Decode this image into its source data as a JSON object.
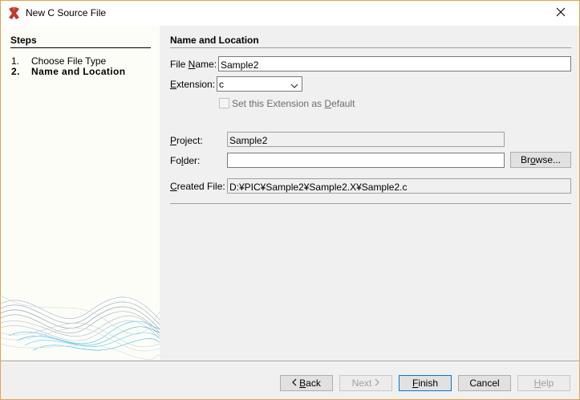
{
  "window": {
    "title": "New C Source File",
    "accent_color": "#e5a34a"
  },
  "steps": {
    "heading": "Steps",
    "items": [
      {
        "num": "1.",
        "label": "Choose File Type"
      },
      {
        "num": "2.",
        "label": "Name and Location"
      }
    ]
  },
  "form": {
    "heading": "Name and Location",
    "file_name_label_pre": "File ",
    "file_name_label_key": "N",
    "file_name_label_post": "ame:",
    "file_name_value": "Sample2",
    "extension_label_key": "E",
    "extension_label_post": "xtension:",
    "extension_value": "c",
    "default_ext_label_pre": "Set this Extension as ",
    "default_ext_label_key": "D",
    "default_ext_label_post": "efault",
    "project_label_key": "P",
    "project_label_post": "roject:",
    "project_value": "Sample2",
    "folder_label_pre": "Fo",
    "folder_label_key": "l",
    "folder_label_post": "der:",
    "folder_value": "",
    "browse_label_pre": "Br",
    "browse_label_key": "o",
    "browse_label_post": "wse...",
    "created_file_label_key": "C",
    "created_file_label_post": "reated File:",
    "created_file_value": "D:¥PIC¥Sample2¥Sample2.X¥Sample2.c"
  },
  "buttons": {
    "back_key": "B",
    "back_post": "ack",
    "next_label": "Next",
    "finish_key": "F",
    "finish_post": "inish",
    "cancel_label": "Cancel",
    "help_key": "H",
    "help_post": "elp"
  },
  "icons": {
    "app": "mplab-x-icon",
    "close": "close-icon",
    "dropdown": "chevron-down-icon"
  }
}
